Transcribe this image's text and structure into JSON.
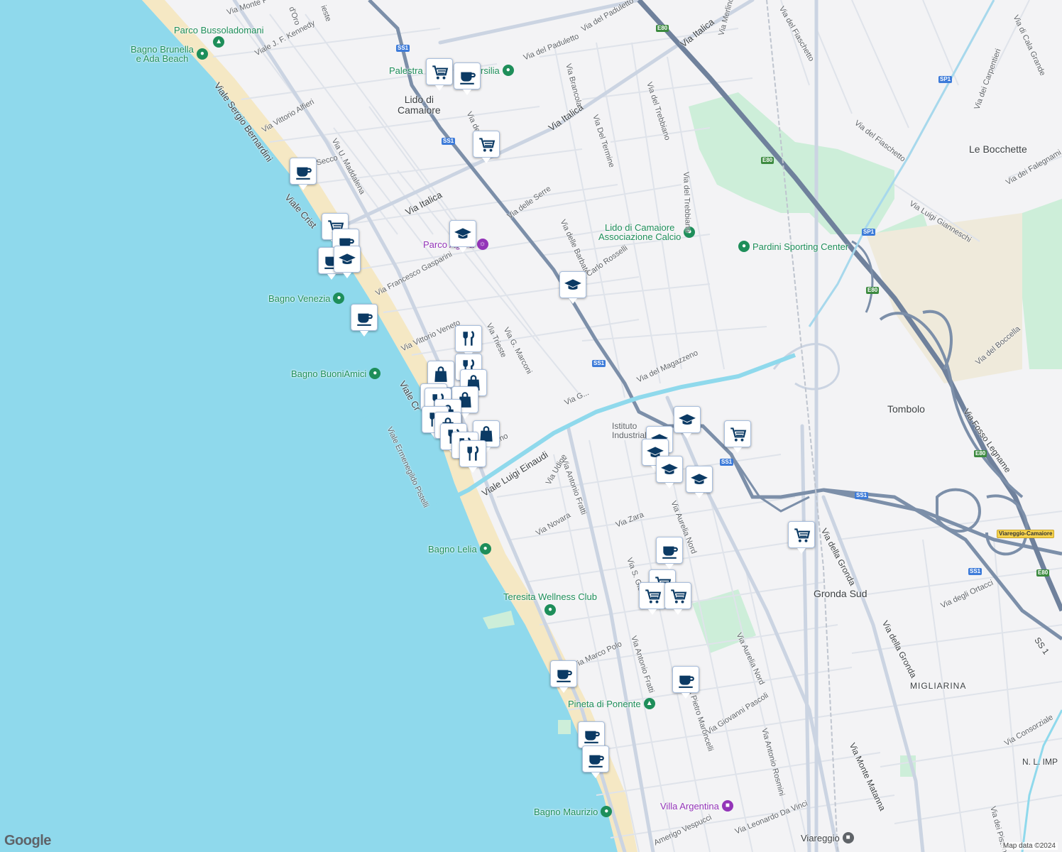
{
  "map": {
    "brand": "Google",
    "attribution": "Map data ©2024",
    "colors": {
      "sea": "#8fd9ec",
      "beach": "#f5e8c4",
      "land": "#f3f3f5",
      "park": "#cdeed9",
      "highway": "#7c8fa9",
      "road": "#d7dee9",
      "canal": "#8fd9ec",
      "marker_icon": "#0b3a64",
      "poi_green": "#1e8e5a",
      "poi_purple": "#9334b8"
    }
  },
  "places": [
    {
      "id": "lido",
      "text": "Lido di\nCamaiore"
    },
    {
      "id": "bocchette",
      "text": "Le Bocchette"
    },
    {
      "id": "tombolo",
      "text": "Tombolo"
    },
    {
      "id": "gronda",
      "text": "Gronda Sud"
    },
    {
      "id": "migliarina",
      "text": "MIGLIARINA"
    },
    {
      "id": "nlimp",
      "text": "N. L. IMP"
    }
  ],
  "pois": [
    {
      "id": "parco-busso",
      "text": "Parco Bussoladomani",
      "kind": "park"
    },
    {
      "id": "bagno-brunella",
      "text": "Bagno Brunella\ne Ada Beach",
      "kind": "green"
    },
    {
      "id": "palestra",
      "text": "Palestra",
      "kind": "green"
    },
    {
      "id": "palestra2",
      "text": "rsilia",
      "kind": "green"
    },
    {
      "id": "parco-agora",
      "text": "Parco Agora",
      "kind": "purple"
    },
    {
      "id": "lido-calcio",
      "text": "Lido di Camaiore\nAssociazione Calcio",
      "kind": "green"
    },
    {
      "id": "pardini",
      "text": "Pardini Sporting Center",
      "kind": "green"
    },
    {
      "id": "bagno-venezia",
      "text": "Bagno Venezia",
      "kind": "green"
    },
    {
      "id": "bagno-buoni",
      "text": "Bagno BuoniAmici",
      "kind": "green"
    },
    {
      "id": "istituto",
      "text": "Istituto\nIndustriale",
      "kind": "plain"
    },
    {
      "id": "bagno-lelia",
      "text": "Bagno Lelia",
      "kind": "green"
    },
    {
      "id": "teresita",
      "text": "Teresita Wellness Club",
      "kind": "green"
    },
    {
      "id": "pineta",
      "text": "Pineta di Ponente",
      "kind": "park"
    },
    {
      "id": "villa-argentina",
      "text": "Villa Argentina",
      "kind": "purple"
    },
    {
      "id": "bagno-maurizio",
      "text": "Bagno Maurizio",
      "kind": "green"
    },
    {
      "id": "viareggio",
      "text": "Viareggio",
      "kind": "plain"
    }
  ],
  "roads": [
    {
      "id": "r1",
      "text": "Via Monte P"
    },
    {
      "id": "r2",
      "text": "d'Oro"
    },
    {
      "id": "r3",
      "text": "ieste"
    },
    {
      "id": "r4",
      "text": "Viale J. F. Kennedy"
    },
    {
      "id": "r5",
      "text": "Viale Sergio Bernardini"
    },
    {
      "id": "r6",
      "text": "Via Vittorio Alfieri"
    },
    {
      "id": "r7",
      "text": "Via U. Maddalena"
    },
    {
      "id": "r8",
      "text": "Secco"
    },
    {
      "id": "r9",
      "text": "Viale Crist"
    },
    {
      "id": "r10",
      "text": "Via Italica"
    },
    {
      "id": "r11",
      "text": "Via Italica"
    },
    {
      "id": "r12",
      "text": "Via Italica"
    },
    {
      "id": "r13",
      "text": "Via del Paduletto"
    },
    {
      "id": "r14",
      "text": "Via del Paduletto"
    },
    {
      "id": "r15",
      "text": "Via Brancola"
    },
    {
      "id": "r16",
      "text": "Via Del Termine"
    },
    {
      "id": "r17",
      "text": "Via del Trebbiano"
    },
    {
      "id": "r18",
      "text": "Via del Trebbiano"
    },
    {
      "id": "r19",
      "text": "Via Merlino"
    },
    {
      "id": "r20",
      "text": "Via del Fiaschetto"
    },
    {
      "id": "r21",
      "text": "Via del Fiaschetto"
    },
    {
      "id": "r22",
      "text": "Via di Cala Grande"
    },
    {
      "id": "r23",
      "text": "Via dei Carpentieri"
    },
    {
      "id": "r24",
      "text": "Via dei Falegnami"
    },
    {
      "id": "r25",
      "text": "Via Luigi Gianneschi"
    },
    {
      "id": "r26",
      "text": "Via delle Serre"
    },
    {
      "id": "r27",
      "text": "Via delle Barbate"
    },
    {
      "id": "r28",
      "text": "Via Carlo Rosselli"
    },
    {
      "id": "r29",
      "text": "Via Francesco Gasparini"
    },
    {
      "id": "r30",
      "text": "Via Vittorio Veneto"
    },
    {
      "id": "r31",
      "text": "Via Trieste"
    },
    {
      "id": "r32",
      "text": "Via G. Marconi"
    },
    {
      "id": "r33",
      "text": "Viale Cr"
    },
    {
      "id": "r34",
      "text": "Viale Ermenegildo Pistelli"
    },
    {
      "id": "r35",
      "text": "Via del Magazzeno"
    },
    {
      "id": "r36",
      "text": "Via G..."
    },
    {
      "id": "r37",
      "text": "Fortino"
    },
    {
      "id": "r38",
      "text": "Viale Luigi Einaudi"
    },
    {
      "id": "r39",
      "text": "Via Udine"
    },
    {
      "id": "r40",
      "text": "Via Antonio Fratti"
    },
    {
      "id": "r41",
      "text": "Via Aurelia Nord"
    },
    {
      "id": "r42",
      "text": "Via Zara"
    },
    {
      "id": "r43",
      "text": "Via Novara"
    },
    {
      "id": "r44",
      "text": "Via S. Gio"
    },
    {
      "id": "r45",
      "text": "Via della Gronda"
    },
    {
      "id": "r46",
      "text": "Via della Gronda"
    },
    {
      "id": "r47",
      "text": "Via degli Ortacci"
    },
    {
      "id": "r48",
      "text": "Via del Boccella"
    },
    {
      "id": "r49",
      "text": "Via Fosso Legname"
    },
    {
      "id": "r50",
      "text": "Via Aurelia Nord"
    },
    {
      "id": "r51",
      "text": "Via Pietro Maroncelli"
    },
    {
      "id": "r52",
      "text": "Via Antonio Fratti"
    },
    {
      "id": "r53",
      "text": "Via Marco Polo"
    },
    {
      "id": "r54",
      "text": "Via Giovanni Pascoli"
    },
    {
      "id": "r55",
      "text": "Via Antonio Rosmini"
    },
    {
      "id": "r56",
      "text": "Via Monte Matanna"
    },
    {
      "id": "r57",
      "text": "Via Consorziale"
    },
    {
      "id": "r58",
      "text": "Via dei Pistoni"
    },
    {
      "id": "r59",
      "text": "Amerigo Vespucci"
    },
    {
      "id": "r60",
      "text": "Via Leonardo Da Vinci"
    },
    {
      "id": "r61",
      "text": "Via della"
    }
  ],
  "shields": [
    {
      "id": "s1",
      "text": "SS1",
      "kind": "ss"
    },
    {
      "id": "s2",
      "text": "SS1",
      "kind": "ss"
    },
    {
      "id": "s3",
      "text": "SS1",
      "kind": "ss"
    },
    {
      "id": "s4",
      "text": "SS1",
      "kind": "ss"
    },
    {
      "id": "s5",
      "text": "SS1",
      "kind": "ss"
    },
    {
      "id": "s6",
      "text": "SS1",
      "kind": "ss"
    },
    {
      "id": "s7",
      "text": "SP1",
      "kind": "ss"
    },
    {
      "id": "s8",
      "text": "SP1",
      "kind": "ss"
    },
    {
      "id": "s9",
      "text": "E80",
      "kind": "e"
    },
    {
      "id": "s10",
      "text": "E80",
      "kind": "e"
    },
    {
      "id": "s11",
      "text": "E80",
      "kind": "e"
    },
    {
      "id": "s12",
      "text": "E80",
      "kind": "e"
    },
    {
      "id": "s13",
      "text": "E80",
      "kind": "e"
    },
    {
      "id": "s14",
      "text": "Viareggio-Camaiore",
      "kind": "toll"
    },
    {
      "id": "s15",
      "text": "SS 1",
      "kind": "plain"
    }
  ],
  "markers": [
    {
      "icon": "cart"
    },
    {
      "icon": "cup"
    },
    {
      "icon": "cart"
    },
    {
      "icon": "cup"
    },
    {
      "icon": "cart"
    },
    {
      "icon": "cup"
    },
    {
      "icon": "cap"
    },
    {
      "icon": "cup"
    },
    {
      "icon": "cap"
    },
    {
      "icon": "cap"
    },
    {
      "icon": "cup"
    },
    {
      "icon": "fork"
    },
    {
      "icon": "fork"
    },
    {
      "icon": "bag"
    },
    {
      "icon": "bag"
    },
    {
      "icon": "bag"
    },
    {
      "icon": "bag"
    },
    {
      "icon": "fork"
    },
    {
      "icon": "bag"
    },
    {
      "icon": "fork"
    },
    {
      "icon": "bag"
    },
    {
      "icon": "fork"
    },
    {
      "icon": "bag"
    },
    {
      "icon": "fork"
    },
    {
      "icon": "fork"
    },
    {
      "icon": "cap"
    },
    {
      "icon": "cart"
    },
    {
      "icon": "cap"
    },
    {
      "icon": "cap"
    },
    {
      "icon": "cap"
    },
    {
      "icon": "cap"
    },
    {
      "icon": "cart"
    },
    {
      "icon": "cup"
    },
    {
      "icon": "cart"
    },
    {
      "icon": "cart"
    },
    {
      "icon": "cart"
    },
    {
      "icon": "cup"
    },
    {
      "icon": "cup"
    },
    {
      "icon": "cup"
    },
    {
      "icon": "cup"
    }
  ]
}
